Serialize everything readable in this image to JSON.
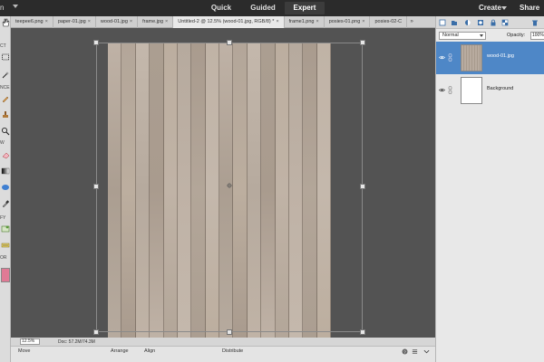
{
  "menu": {
    "left_label": "n"
  },
  "modes": [
    {
      "label": "Quick"
    },
    {
      "label": "Guided"
    },
    {
      "label": "Expert"
    }
  ],
  "header": {
    "create_label": "Create",
    "share_label": "Share"
  },
  "toolbox": {
    "section_labels": [
      "CT",
      "NCE",
      "W",
      "FY",
      "OR"
    ]
  },
  "tabs": [
    {
      "label": "teepee6.png"
    },
    {
      "label": "paper-01.jpg"
    },
    {
      "label": "wood-01.jpg"
    },
    {
      "label": "frame.jpg"
    },
    {
      "label": "Untitled-2 @ 12.5% (wood-01.jpg, RGB/8) *"
    },
    {
      "label": "frame1.png"
    },
    {
      "label": "posies-01.png"
    },
    {
      "label": "posies-02-C"
    }
  ],
  "tab_more": "»",
  "status": {
    "zoom": "12.5%",
    "doc": "Doc: 57.2M/74.3M"
  },
  "options": {
    "move": "Move",
    "arrange": "Arrange",
    "align": "Align",
    "distribute": "Distribute"
  },
  "layers_panel": {
    "blend_mode": "Normal",
    "opacity_label": "Opacity:",
    "opacity_value": "100%",
    "layers": [
      {
        "name": "wood-01.jpg",
        "selected": true
      },
      {
        "name": "Background",
        "selected": false
      }
    ]
  },
  "colors": {
    "selected_layer": "#4e87c7",
    "wood": "#b8ab9f",
    "canvas_bg": "#535353"
  }
}
